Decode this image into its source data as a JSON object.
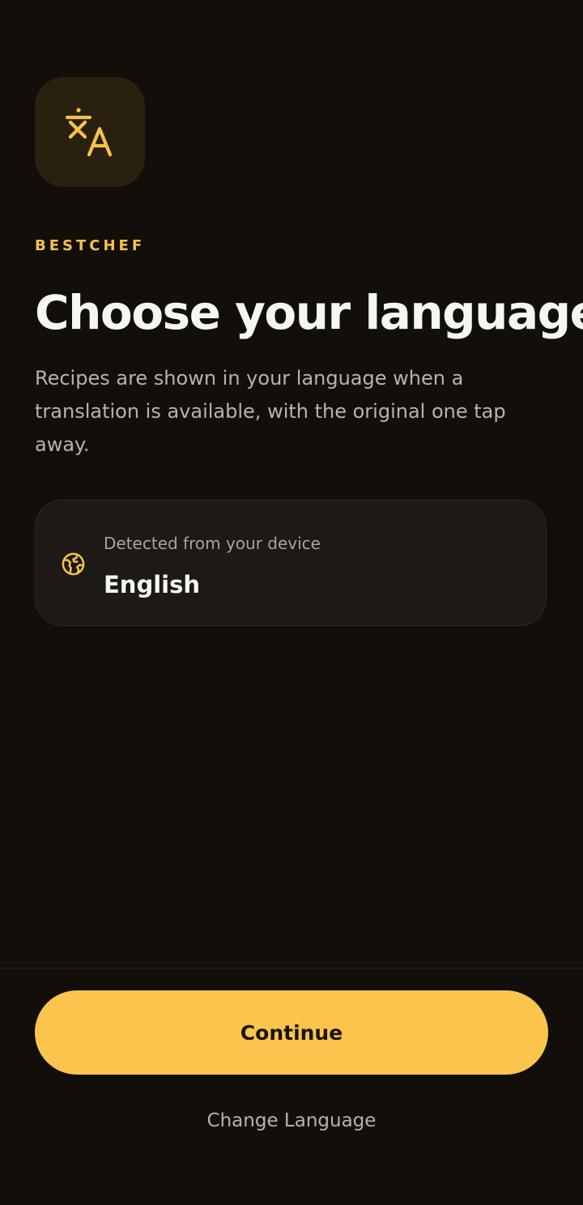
{
  "brand": {
    "name": "BESTCHEF",
    "icon": "translate-icon",
    "accent_color": "#f7c24a"
  },
  "header": {
    "title": "Choose your language",
    "subtitle": "Recipes are shown in your language when a translation is available, with the original one tap away."
  },
  "detected": {
    "icon": "globe-icon",
    "label": "Detected from your device",
    "language": "English"
  },
  "actions": {
    "continue_label": "Continue",
    "change_language_label": "Change Language",
    "primary_color": "#fbc54d"
  }
}
